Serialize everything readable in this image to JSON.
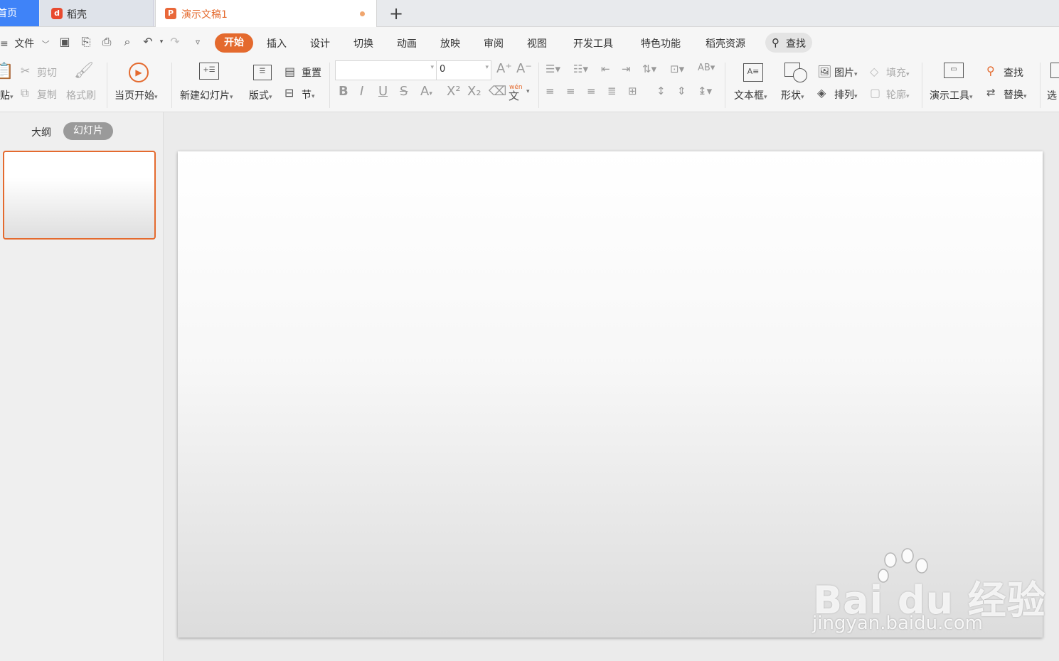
{
  "tabs": {
    "home": "首页",
    "docer": "稻壳",
    "document": "演示文稿1",
    "new_tab": "+"
  },
  "menu": {
    "file": "文件",
    "items": [
      "开始",
      "插入",
      "设计",
      "切换",
      "动画",
      "放映",
      "审阅",
      "视图",
      "开发工具",
      "特色功能",
      "稻壳资源"
    ],
    "search": "查找"
  },
  "ribbon": {
    "paste": "贴",
    "cut": "剪切",
    "copy": "复制",
    "format_painter": "格式刷",
    "start_from_current": "当页开始",
    "new_slide": "新建幻灯片",
    "layout": "版式",
    "reset": "重置",
    "section": "节",
    "font_name": "",
    "font_size": "0",
    "textbox": "文本框",
    "shape": "形状",
    "picture": "图片",
    "arrange": "排列",
    "fill": "填充",
    "outline": "轮廓",
    "presentation_tools": "演示工具",
    "find": "查找",
    "replace": "替换",
    "select": "选",
    "phonetic": "wén"
  },
  "left_pane": {
    "outline_tab": "大纲",
    "slides_tab": "幻灯片"
  },
  "watermark": {
    "logo": "Bai du 经验",
    "url": "jingyan.baidu.com"
  },
  "colors": {
    "accent": "#e46a2e",
    "home_tab": "#3f83f8"
  }
}
